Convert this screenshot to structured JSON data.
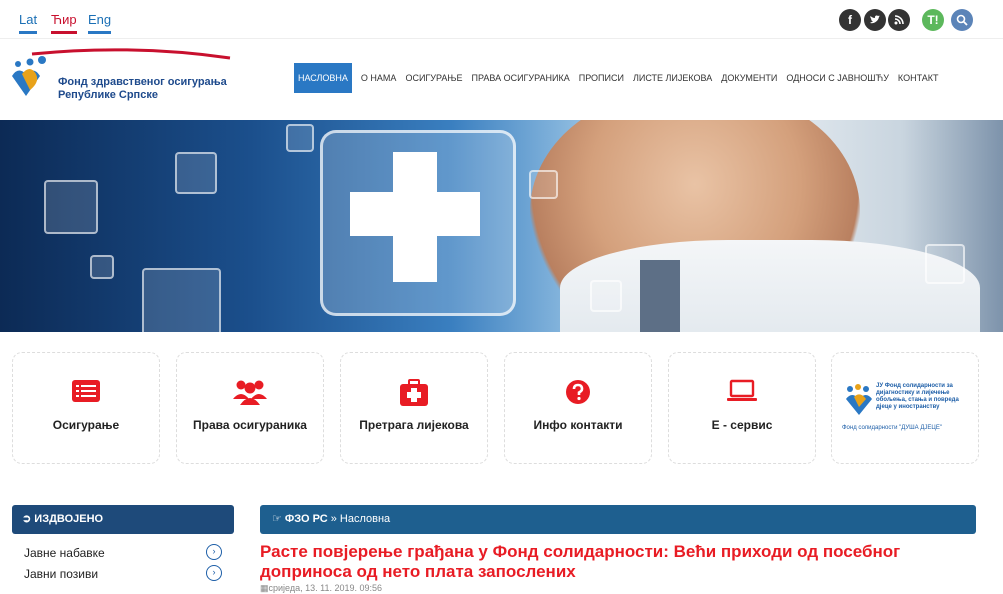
{
  "languages": [
    {
      "label": "Lat"
    },
    {
      "label": "Ћир"
    },
    {
      "label": "Eng"
    }
  ],
  "social": {
    "fb": "f",
    "tw": "t",
    "rss": "r",
    "t": "T!",
    "search": "🔍"
  },
  "logo": {
    "line1": "Фонд здравственог осигурања",
    "line2": "Републике Српске"
  },
  "nav": [
    {
      "label": "НАСЛОВНА"
    },
    {
      "label": "О НАМА"
    },
    {
      "label": "ОСИГУРАЊЕ"
    },
    {
      "label": "ПРАВА ОСИГУРАНИКА"
    },
    {
      "label": "ПРОПИСИ"
    },
    {
      "label": "ЛИСТЕ ЛИЈЕКОВА"
    },
    {
      "label": "ДОКУМЕНТИ"
    },
    {
      "label": "ОДНОСИ С ЈАВНОШЋУ"
    },
    {
      "label": "КОНТАКТ"
    }
  ],
  "cards": [
    {
      "label": "Осигурање",
      "icon": "list-icon"
    },
    {
      "label": "Права осигураника",
      "icon": "users-icon"
    },
    {
      "label": "Претрага лијекова",
      "icon": "first-aid-icon"
    },
    {
      "label": "Инфо контакти",
      "icon": "question-icon"
    },
    {
      "label": "Е - сервис",
      "icon": "laptop-icon"
    }
  ],
  "fund_card": {
    "text": "ЈУ Фонд солидарности за дијагностику и лијечење обољења, стања и повреда дјеце у иностранству",
    "bottom": "Фонд солидарности \"ДУША ДЈЕЦЕ\""
  },
  "sidebar": {
    "title": "ИЗДВОЈЕНО",
    "items": [
      {
        "label": "Јавне набавке"
      },
      {
        "label": "Јавни позиви"
      }
    ]
  },
  "breadcrumb": {
    "home": "ФЗО РС",
    "current": "Насловна"
  },
  "news": {
    "title": "Расте повјерење грађана у Фонд солидарности: Већи приходи од посебног доприноса од нето плата запослених",
    "date": "сриједа, 13. 11. 2019. 09:56"
  },
  "colors": {
    "accent": "#2a78c4",
    "red": "#e81c24",
    "dark_blue": "#1e4a7a"
  }
}
